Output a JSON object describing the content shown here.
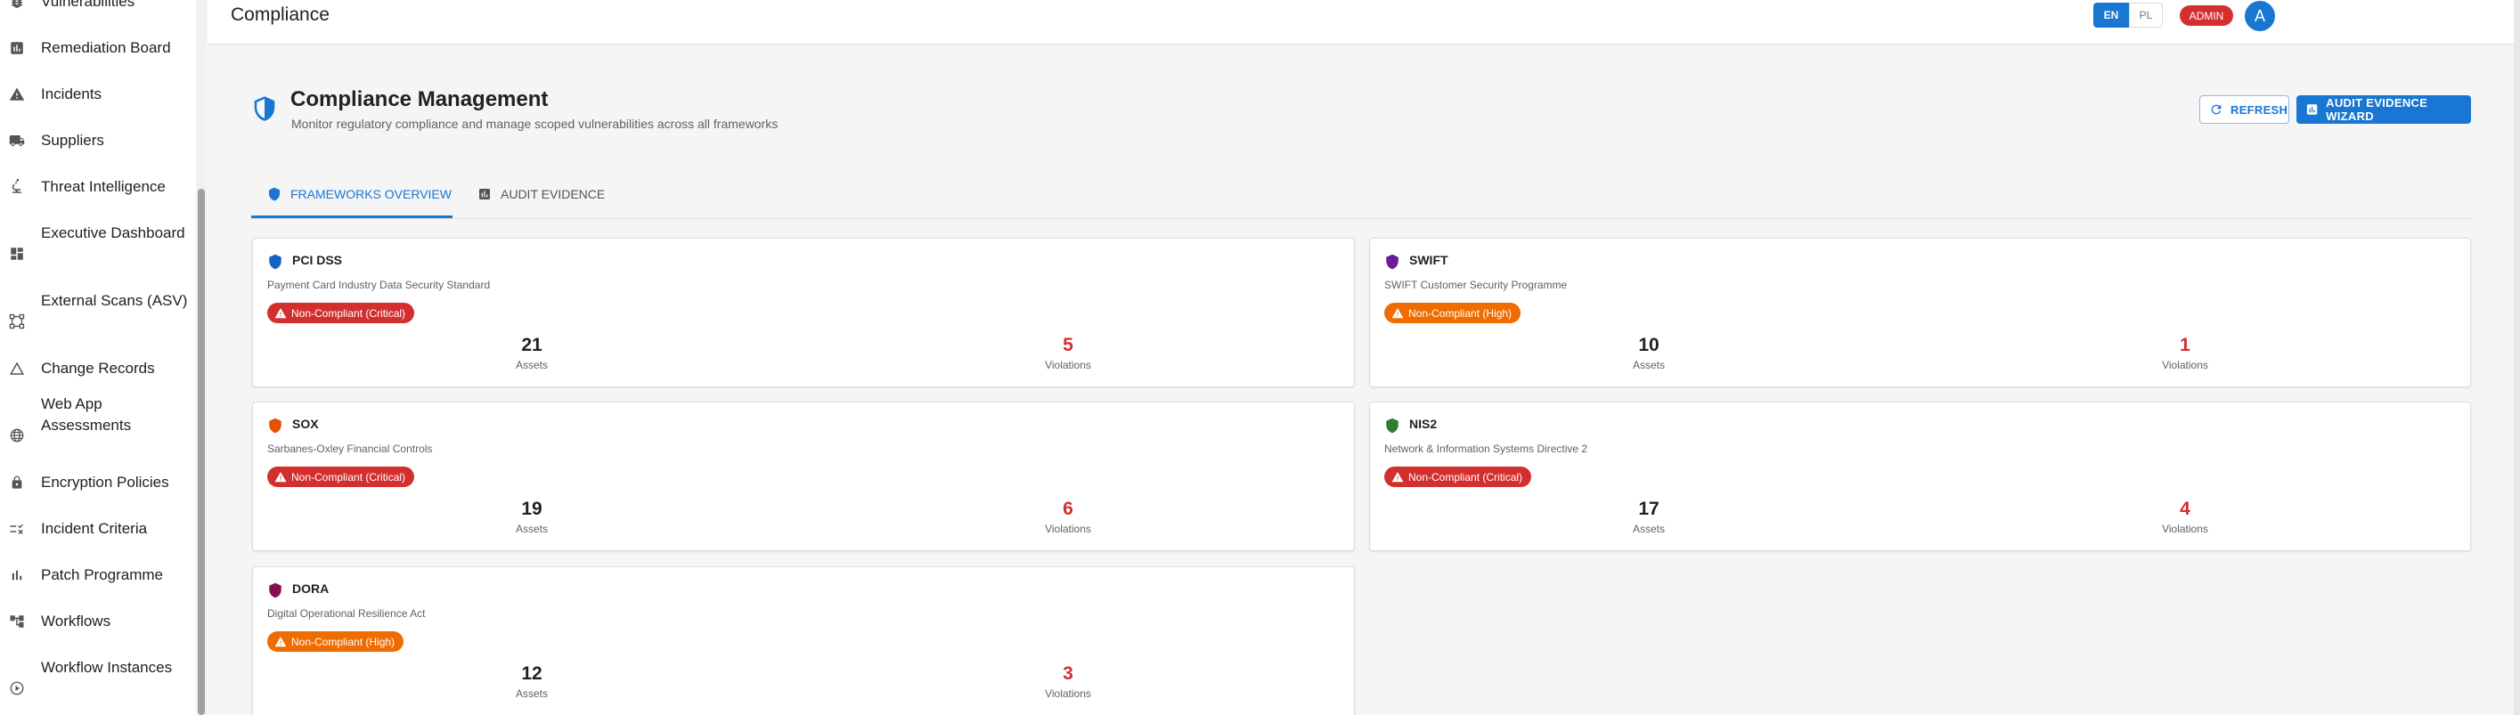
{
  "sidebar": {
    "items": [
      {
        "label": "Vulnerabilities",
        "icon": "bug-icon"
      },
      {
        "label": "Remediation Board",
        "icon": "board-icon"
      },
      {
        "label": "Incidents",
        "icon": "warning-icon"
      },
      {
        "label": "Suppliers",
        "icon": "truck-icon"
      },
      {
        "label": "Threat Intelligence",
        "icon": "microscope-icon"
      },
      {
        "label": "Executive Dashboard",
        "icon": "dashboard-icon"
      },
      {
        "label": "External Scans (ASV)",
        "icon": "scan-network-icon"
      },
      {
        "label": "Change Records",
        "icon": "triangle-icon"
      },
      {
        "label": "Web App Assessments",
        "icon": "globe-icon"
      },
      {
        "label": "Encryption Policies",
        "icon": "lock-icon"
      },
      {
        "label": "Incident Criteria",
        "icon": "rule-icon"
      },
      {
        "label": "Patch Programme",
        "icon": "bar-chart-icon"
      },
      {
        "label": "Workflows",
        "icon": "workflow-icon"
      },
      {
        "label": "Workflow Instances",
        "icon": "play-circle-icon"
      }
    ]
  },
  "topbar": {
    "title": "Compliance",
    "lang_en": "EN",
    "lang_pl": "PL",
    "role_badge": "ADMIN",
    "avatar_letter": "A"
  },
  "header": {
    "title": "Compliance Management",
    "subtitle": "Monitor regulatory compliance and manage scoped vulnerabilities across all frameworks",
    "refresh_label": "REFRESH",
    "wizard_label": "AUDIT EVIDENCE WIZARD"
  },
  "tabs": [
    {
      "label": "FRAMEWORKS OVERVIEW",
      "active": true
    },
    {
      "label": "AUDIT EVIDENCE",
      "active": false
    }
  ],
  "labels": {
    "assets": "Assets",
    "violations": "Violations"
  },
  "frameworks": [
    {
      "name": "PCI DSS",
      "description": "Payment Card Industry Data Security Standard",
      "status": "Non-Compliant (Critical)",
      "severity": "critical",
      "assets": "21",
      "violations": "5",
      "color": "#1565c0"
    },
    {
      "name": "SWIFT",
      "description": "SWIFT Customer Security Programme",
      "status": "Non-Compliant (High)",
      "severity": "high",
      "assets": "10",
      "violations": "1",
      "color": "#6a1b9a"
    },
    {
      "name": "SOX",
      "description": "Sarbanes-Oxley Financial Controls",
      "status": "Non-Compliant (Critical)",
      "severity": "critical",
      "assets": "19",
      "violations": "6",
      "color": "#e65100"
    },
    {
      "name": "NIS2",
      "description": "Network & Information Systems Directive 2",
      "status": "Non-Compliant (Critical)",
      "severity": "critical",
      "assets": "17",
      "violations": "4",
      "color": "#2e7d32"
    },
    {
      "name": "DORA",
      "description": "Digital Operational Resilience Act",
      "status": "Non-Compliant (High)",
      "severity": "high",
      "assets": "12",
      "violations": "3",
      "color": "#880e4f"
    }
  ],
  "colors": {
    "primary": "#1976d2",
    "critical": "#d32f2f",
    "high": "#ef6c00"
  }
}
